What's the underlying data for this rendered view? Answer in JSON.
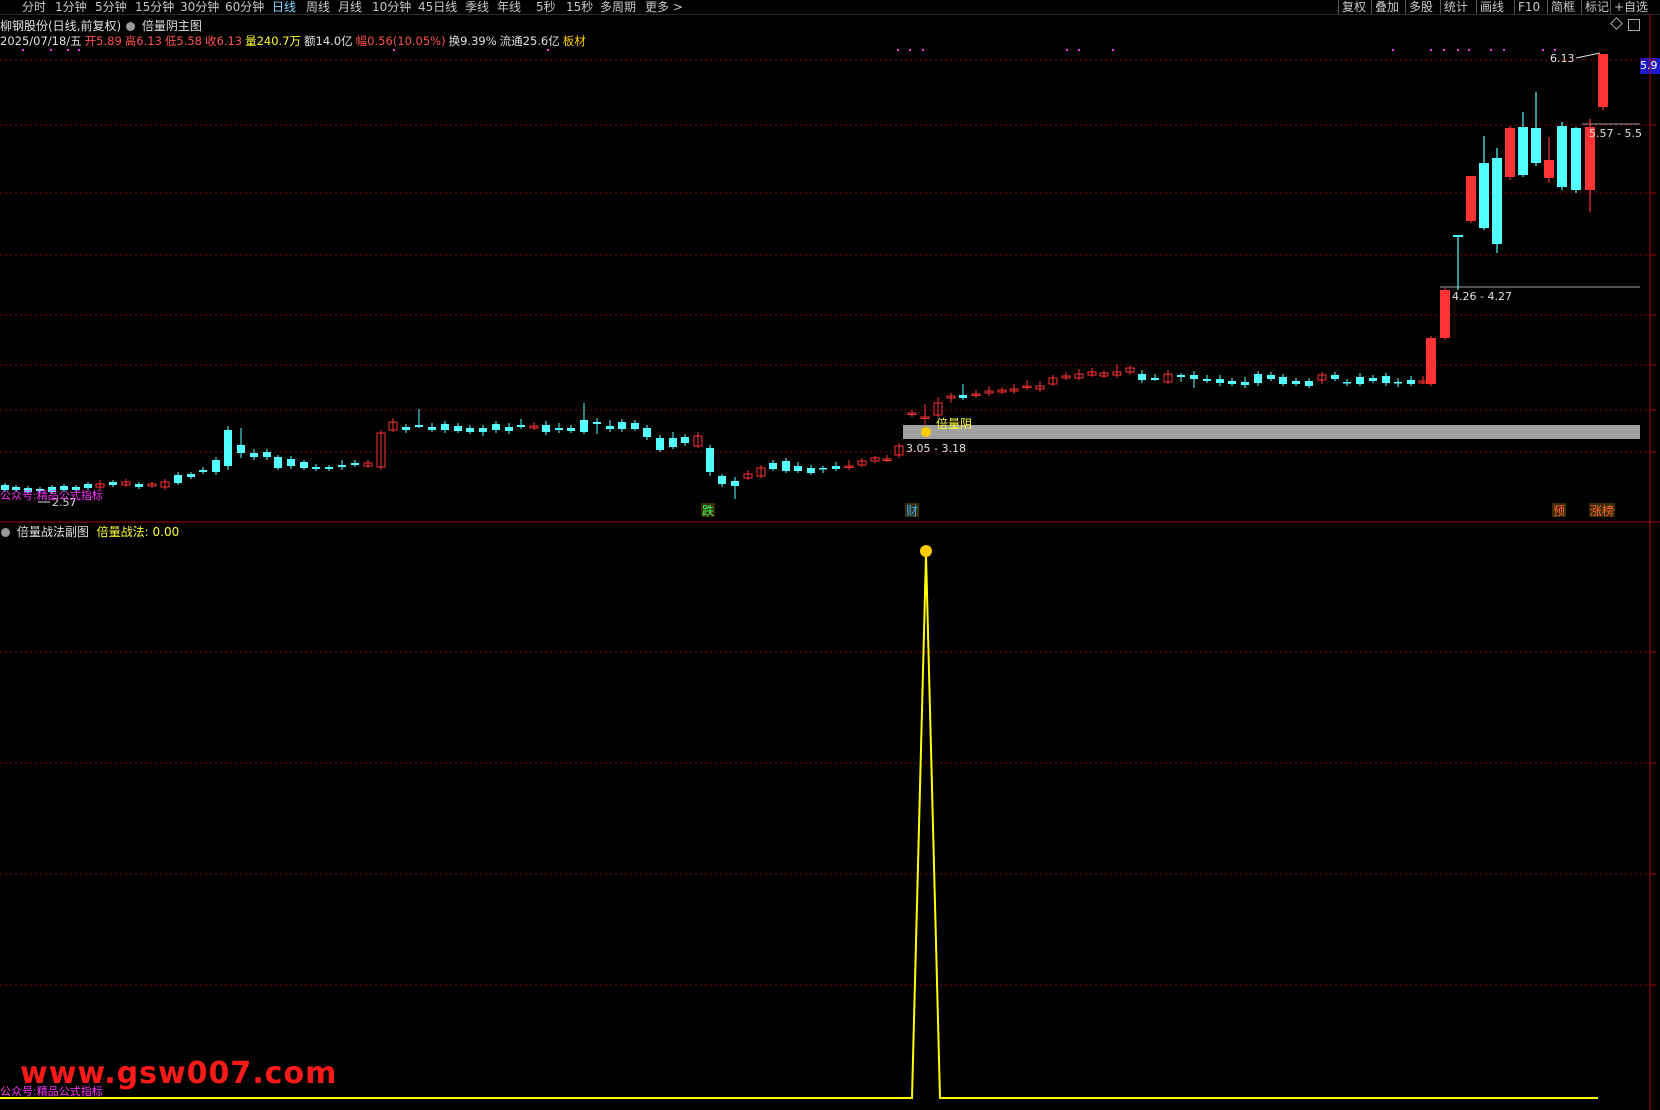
{
  "toolbar": {
    "periods": [
      "分时",
      "1分钟",
      "5分钟",
      "15分钟",
      "30分钟",
      "60分钟",
      "日线",
      "周线",
      "月线",
      "10分钟",
      "45日线",
      "季线",
      "年线",
      "5秒",
      "15秒",
      "多周期",
      "更多 >"
    ],
    "active_period": "日线",
    "right_items": [
      "复权",
      "叠加",
      "多股",
      "统计",
      "画线",
      "F10",
      "简框",
      "标记",
      "+自选"
    ]
  },
  "header": {
    "title": "柳钢股份(日线,前复权)",
    "indicator": "倍量阴主图",
    "date": "2025/07/18/五",
    "open_label": "开",
    "open": "5.89",
    "high_label": "高",
    "high": "6.13",
    "low_label": "低",
    "low": "5.58",
    "close_label": "收",
    "close": "6.13",
    "vol_label": "量",
    "vol": "240.7万",
    "amt_label": "额",
    "amt": "14.0亿",
    "chg_label": "幅",
    "chg": "0.56(10.05%)",
    "turn_label": "换",
    "turn": "9.39%",
    "float_label": "流通",
    "float": "25.6亿",
    "sector": "板材"
  },
  "main_chart": {
    "price_scale_label": "5.9",
    "high_marker": "6.13",
    "low_marker": "2.57",
    "zones": [
      {
        "label": "3.05 - 3.18"
      },
      {
        "label": "4.26 - 4.27"
      },
      {
        "label": "5.57 - 5.5"
      }
    ],
    "signal_label": "倍量阴",
    "event_tags": [
      "跌",
      "财",
      "预",
      "涨榜"
    ],
    "pub_label": "公众号:精品公式指标"
  },
  "sub_chart": {
    "title": "倍量战法副图",
    "value_label": "倍量战法:",
    "value": "0.00",
    "pub_label": "公众号:精品公式指标"
  },
  "watermark": "www.gsw007.com",
  "colors": {
    "up": "#ff3333",
    "down": "#54ffff",
    "grid": "#8b0000",
    "signal_line": "#ffff00",
    "zone": "#a0a0a0",
    "magenta": "#ff33ff"
  }
}
